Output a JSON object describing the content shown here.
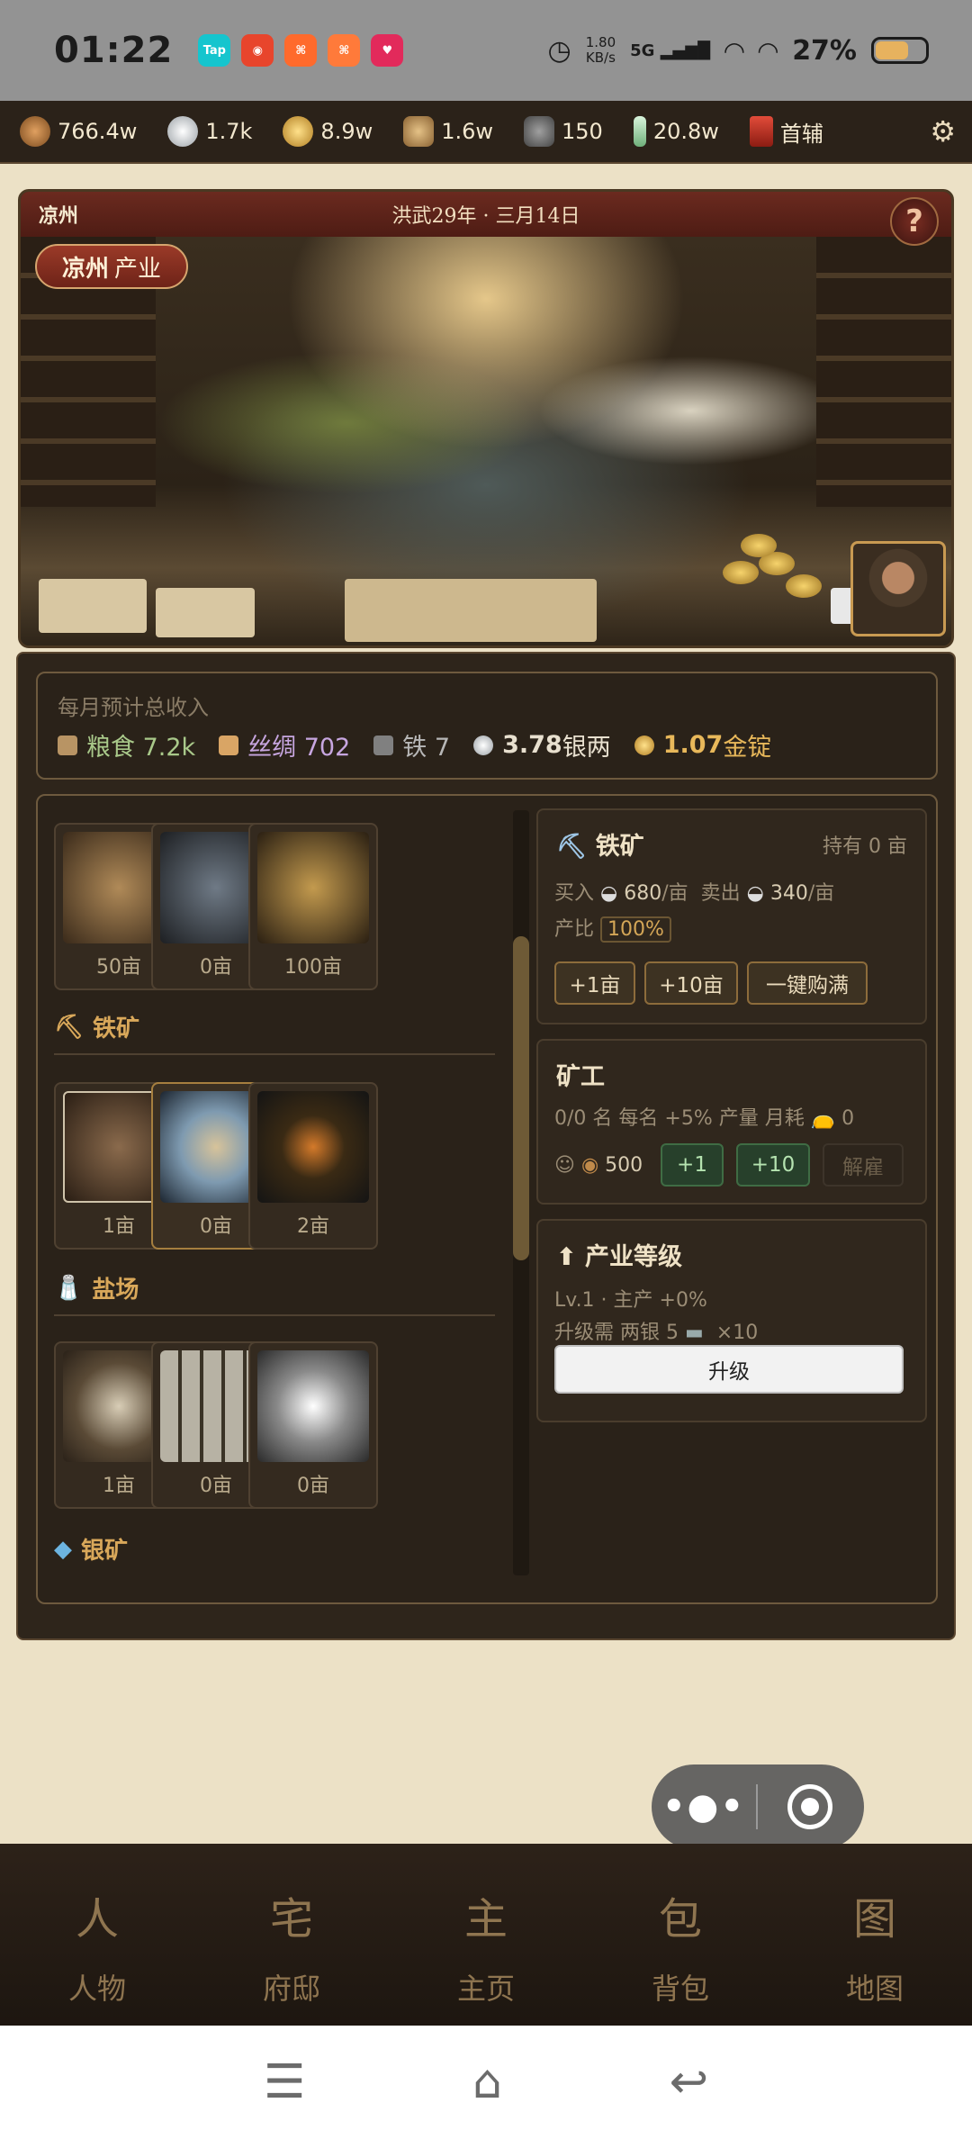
{
  "status_bar": {
    "time": "01:22",
    "apps": [
      {
        "name": "taptap-app-icon",
        "label": "Tap",
        "color": "#15c5ce"
      },
      {
        "name": "weibo-app-icon",
        "label": "",
        "color": "#e8452c"
      },
      {
        "name": "kuaishou-app-icon",
        "label": "",
        "color": "#ff6a2c"
      },
      {
        "name": "kuaishou-lite-app-icon",
        "label": "",
        "color": "#ff7a3a"
      },
      {
        "name": "pinduoduo-app-icon",
        "label": "",
        "color": "#e22a5b"
      }
    ],
    "speed_value": "1.80",
    "speed_unit": "KB/s",
    "network": "5G",
    "battery_pct": "27%",
    "battery_level": 0.27
  },
  "resources": [
    {
      "icon": "copper-coin-icon",
      "value": "766.4w",
      "color": "#b57a3a"
    },
    {
      "icon": "silver-ingot-icon",
      "value": "1.7k",
      "color": "#cfd3d6"
    },
    {
      "icon": "gold-ingot-icon",
      "value": "8.9w",
      "color": "#e0b448"
    },
    {
      "icon": "grain-sack-icon",
      "value": "1.6w",
      "color": "#c49a5a"
    },
    {
      "icon": "iron-ore-icon",
      "value": "150",
      "color": "#7b7b7b"
    },
    {
      "icon": "jade-icon",
      "value": "20.8w",
      "color": "#9fd3a8"
    }
  ],
  "rank": {
    "label": "首辅",
    "icon": "official-hat-icon"
  },
  "banner": {
    "city": "凉州",
    "date": "洪武29年 · 三月14日",
    "help_label": "?",
    "sector_city": "凉州",
    "sector_label": "产业"
  },
  "income": {
    "title": "每月预计总收入",
    "items": [
      {
        "icon": "grain-icon",
        "label": "粮食 7.2k",
        "color": "#a9c98a"
      },
      {
        "icon": "silk-icon",
        "label": "丝绸 702",
        "color": "#c7a6e0"
      },
      {
        "icon": "iron-icon",
        "label": "铁 7",
        "color": "#b7b7b7"
      },
      {
        "icon": "silver-icon",
        "value": "3.78",
        "unit": "银两",
        "color": "#e8e0cf"
      },
      {
        "icon": "gold-icon",
        "value": "1.07",
        "unit": "金锭",
        "color": "#e8b85a"
      }
    ]
  },
  "industry_list": {
    "top_row": [
      "50亩",
      "0亩",
      "100亩"
    ],
    "categories": [
      {
        "label": "铁矿",
        "icon": "pickaxe-icon",
        "cells": [
          "1亩",
          "0亩",
          "2亩"
        ]
      },
      {
        "label": "盐场",
        "icon": "salt-shaker-icon",
        "cells": [
          "1亩",
          "0亩",
          "0亩"
        ]
      },
      {
        "label": "银矿",
        "icon": "diamond-icon",
        "cells": []
      }
    ]
  },
  "detail": {
    "title": "铁矿",
    "owned": "持有 0 亩",
    "buy_label": "买入",
    "buy_price": "680",
    "sell_label": "卖出",
    "sell_price": "340",
    "per_unit": "/亩",
    "ratio_label": "产比",
    "ratio": "100%",
    "buttons": [
      "+1亩",
      "+10亩",
      "一键购满"
    ]
  },
  "workers": {
    "title": "矿工",
    "desc": "0/0 名  每名 +5% 产量  月耗",
    "monthly_cost": "0",
    "hire_cost": "500",
    "btn_plus1": "+1",
    "btn_plus10": "+10",
    "btn_fire": "解雇"
  },
  "level": {
    "title": "产业等级",
    "line1": "Lv.1 · 主产 +0%",
    "line2_prefix": "升级需 两银 5",
    "line2_suffix": "×10",
    "button": "升级"
  },
  "capsule": {
    "more": "•●•"
  },
  "bottom_nav": [
    {
      "glyph": "人",
      "label": "人物"
    },
    {
      "glyph": "宅",
      "label": "府邸"
    },
    {
      "glyph": "主",
      "label": "主页"
    },
    {
      "glyph": "包",
      "label": "背包"
    },
    {
      "glyph": "图",
      "label": "地图"
    }
  ],
  "system_nav": {
    "menu": "☰",
    "home": "⌂",
    "back": "↩"
  }
}
